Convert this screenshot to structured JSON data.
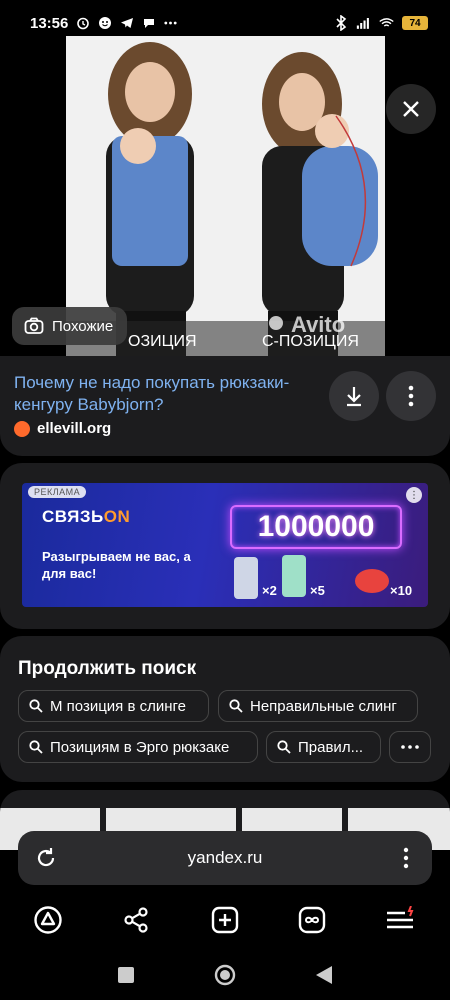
{
  "status_bar": {
    "time": "13:56",
    "battery": "74",
    "left_icons": [
      "alarm-icon",
      "face-icon",
      "telegram-icon",
      "chat-icon",
      "more-dots-icon"
    ],
    "right_icons": [
      "bluetooth-icon",
      "signal-icon",
      "wifi-icon",
      "battery-icon"
    ]
  },
  "image_viewer": {
    "similar_button": "Похожие",
    "photo_caption_left": "ОЗИЦИЯ",
    "photo_caption_right": "С-ПОЗИЦИЯ",
    "watermark": "Avito"
  },
  "result": {
    "title": "Почему не надо покупать рюкзаки-кенгуру Babybjorn?",
    "source": "ellevill.org"
  },
  "ad": {
    "badge": "РЕКЛАМА",
    "brand": "СВЯЗЬ",
    "brand_suffix": "ON",
    "text": "Разыгрываем не вас, а для вас!",
    "prize": "1000000",
    "mult1": "×2",
    "mult2": "×5",
    "mult3": "×10"
  },
  "continue_search": {
    "title": "Продолжить поиск",
    "chips": [
      "М позиция в слинге",
      "Неправильные слинг",
      "Позициям в Эрго рюкзаке",
      "Правил..."
    ]
  },
  "address_bar": {
    "url": "yandex.ru"
  },
  "colors": {
    "link": "#7fb2f0",
    "card": "#1c1c1e",
    "source_dot": "#ff6a2c",
    "battery": "#e6b43a"
  }
}
